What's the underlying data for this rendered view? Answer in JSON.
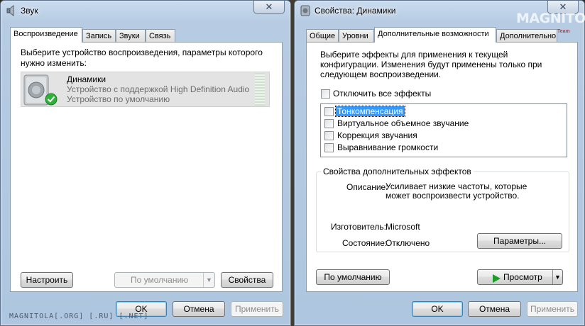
{
  "left_window": {
    "title": "Звук",
    "tabs": [
      "Воспроизведение",
      "Запись",
      "Звуки",
      "Связь"
    ],
    "instruction": "Выберите устройство воспроизведения, параметры которого нужно изменить:",
    "device": {
      "name": "Динамики",
      "description": "Устройство с поддержкой High Definition Audio",
      "status": "Устройство по умолчанию"
    },
    "configure_label": "Настроить",
    "set_default_label": "По умолчанию",
    "properties_label": "Свойства",
    "ok_label": "OK",
    "cancel_label": "Отмена",
    "apply_label": "Применить"
  },
  "right_window": {
    "title": "Свойства: Динамики",
    "tabs": [
      "Общие",
      "Уровни",
      "Дополнительные возможности",
      "Дополнительно"
    ],
    "instruction": "Выберите эффекты для применения к текущей конфигурации. Изменения будут применены только при следующем воспроизведении.",
    "disable_all_label": "Отключить все эффекты",
    "effects": [
      "Тонкомпенсация",
      "Виртуальное объемное звучание",
      "Коррекция звучания",
      "Выравнивание громкости"
    ],
    "group_title": "Свойства дополнительных эффектов",
    "description_label": "Описание:",
    "description_value": "Усиливает низкие частоты, которые может воспроизвести устройство.",
    "manufacturer_label": "Изготовитель:",
    "manufacturer_value": "Microsoft",
    "state_label": "Состояние:",
    "state_value": "Отключено",
    "settings_label": "Параметры...",
    "restore_default_label": "По умолчанию",
    "preview_label": "Просмотр",
    "ok_label": "OK",
    "cancel_label": "Отмена",
    "apply_label": "Применить"
  },
  "watermark": {
    "brand": "MAGNITOLA",
    "team": "Team",
    "footer": "MAGNITOLA[.ORG] [.RU] [.NET]"
  },
  "colors": {
    "selection": "#3399ff",
    "window_frame": "#b7cce3",
    "play_icon": "#1f9b2a",
    "check_badge": "#2fb13a"
  },
  "icons": {
    "speaker": "speaker-icon",
    "default_check": "check-badge-icon",
    "play": "play-icon",
    "dropdown": "chevron-down-icon",
    "close": "close-icon"
  }
}
